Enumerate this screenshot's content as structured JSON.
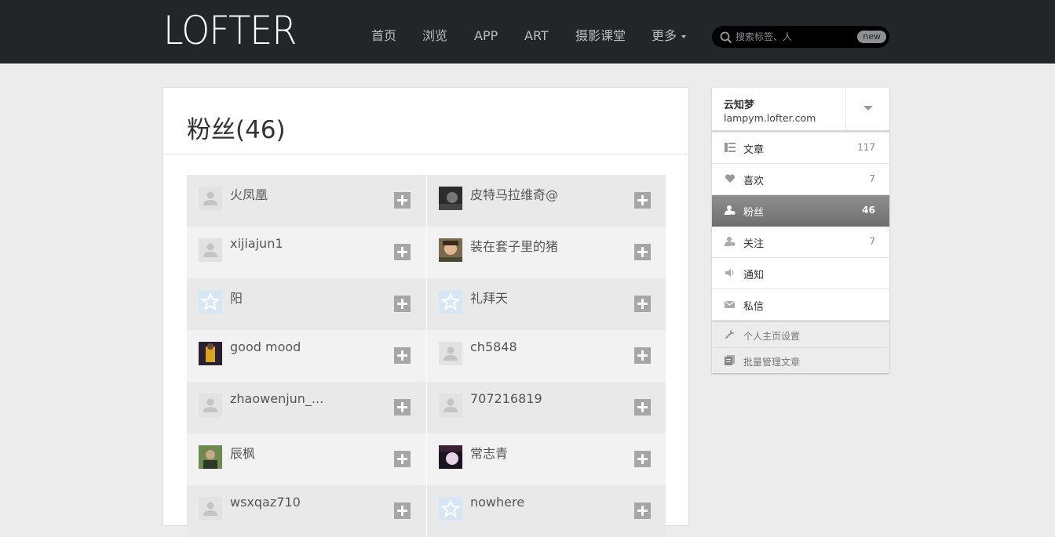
{
  "header": {
    "logo": "LOFTER",
    "nav": [
      {
        "label": "首页"
      },
      {
        "label": "浏览"
      },
      {
        "label": "APP"
      },
      {
        "label": "ART"
      },
      {
        "label": "摄影课堂"
      },
      {
        "label": "更多"
      }
    ],
    "search": {
      "placeholder": "搜索标签、人",
      "badge": "new"
    }
  },
  "main": {
    "title": "粉丝(46)",
    "followers": [
      {
        "name": "火凤凰",
        "avatar": "default"
      },
      {
        "name": "皮特马拉维奇@",
        "avatar": "photo-dark"
      },
      {
        "name": "xijiajun1",
        "avatar": "default"
      },
      {
        "name": "装在套子里的猪",
        "avatar": "photo-face"
      },
      {
        "name": "阳",
        "avatar": "star"
      },
      {
        "name": "礼拜天",
        "avatar": "star"
      },
      {
        "name": "good mood",
        "avatar": "photo-yellow"
      },
      {
        "name": "ch5848",
        "avatar": "default"
      },
      {
        "name": "zhaowenjun_...",
        "avatar": "default"
      },
      {
        "name": "707216819",
        "avatar": "default"
      },
      {
        "name": "辰枫",
        "avatar": "photo-green"
      },
      {
        "name": "常志青",
        "avatar": "photo-pink"
      },
      {
        "name": "wsxqaz710",
        "avatar": "default"
      },
      {
        "name": "nowhere",
        "avatar": "star"
      }
    ]
  },
  "sidebar": {
    "profile": {
      "name": "云知梦",
      "url": "lampym.lofter.com"
    },
    "menu": [
      {
        "label": "文章",
        "count": "117",
        "icon": "list-icon"
      },
      {
        "label": "喜欢",
        "count": "7",
        "icon": "heart-icon"
      },
      {
        "label": "粉丝",
        "count": "46",
        "icon": "fans-icon",
        "active": true
      },
      {
        "label": "关注",
        "count": "7",
        "icon": "follow-icon"
      },
      {
        "label": "通知",
        "count": "",
        "icon": "speaker-icon"
      },
      {
        "label": "私信",
        "count": "",
        "icon": "mail-icon"
      }
    ],
    "tools": [
      {
        "label": "个人主页设置",
        "icon": "wrench-icon"
      },
      {
        "label": "批量管理文章",
        "icon": "document-icon"
      }
    ]
  }
}
